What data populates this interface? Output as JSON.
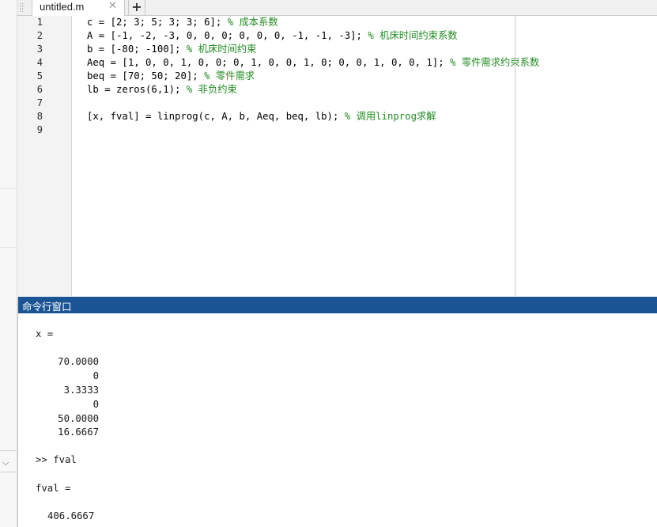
{
  "editor": {
    "tab_label": "untitled.m",
    "tab_close_glyph": "✕",
    "tab_add_glyph": "+",
    "line_numbers": [
      "1",
      "2",
      "3",
      "4",
      "5",
      "6",
      "7",
      "8",
      "9"
    ],
    "lines": [
      {
        "code": "c = [2; 3; 5; 3; 3; 6]; ",
        "comment": "% 成本系数"
      },
      {
        "code": "A = [-1, -2, -3, 0, 0, 0; 0, 0, 0, -1, -1, -3]; ",
        "comment": "% 机床时间约束系数"
      },
      {
        "code": "b = [-80; -100]; ",
        "comment": "% 机床时间约束"
      },
      {
        "code": "Aeq = [1, 0, 0, 1, 0, 0; 0, 1, 0, 0, 1, 0; 0, 0, 1, 0, 0, 1]; ",
        "comment": "% 零件需求约束系数"
      },
      {
        "code": "beq = [70; 50; 20]; ",
        "comment": "% 零件需求"
      },
      {
        "code": "lb = zeros(6,1); ",
        "comment": "% 非负约束"
      },
      {
        "code": "",
        "comment": ""
      },
      {
        "code": "[x, fval] = linprog(c, A, b, Aeq, beq, lb); ",
        "comment": "% 调用linprog求解"
      },
      {
        "code": "",
        "comment": ""
      }
    ]
  },
  "command_window": {
    "title": "命令行窗口",
    "x_header": "x =",
    "x_values": [
      "70.0000",
      "0",
      "3.3333",
      "0",
      "50.0000",
      "16.6667"
    ],
    "prompt": ">> fval",
    "fval_header": "fval =",
    "fval_value": "406.6667"
  },
  "colors": {
    "comment": "#228b22",
    "command_title_bg": "#1a5494"
  }
}
